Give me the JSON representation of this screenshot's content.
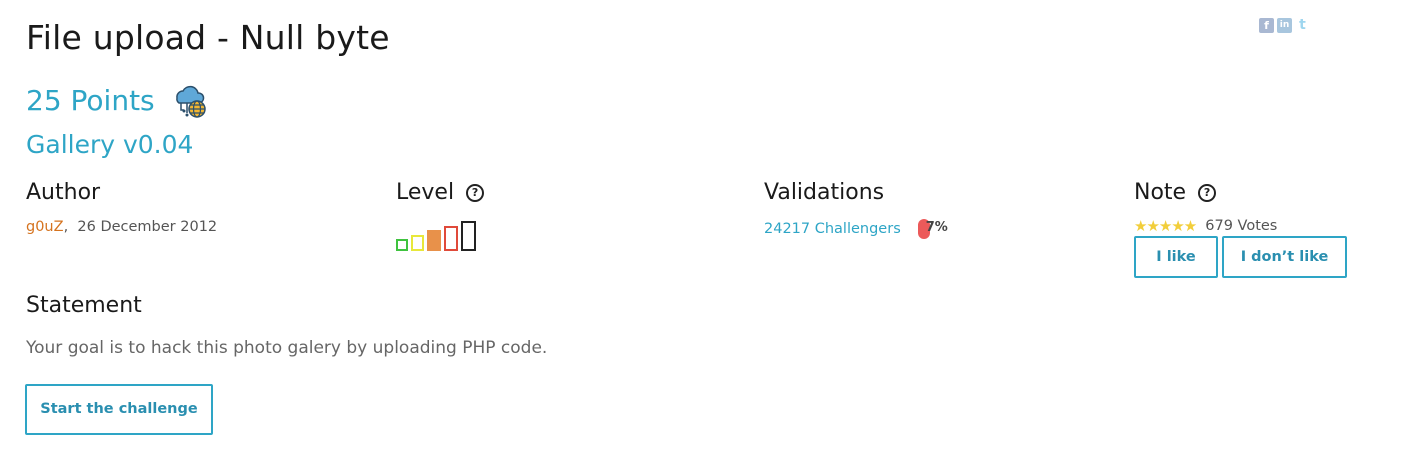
{
  "challenge": {
    "title": "File upload - Null byte",
    "points": "25 Points",
    "subtitle": "Gallery v0.04"
  },
  "social": {
    "facebook": "f",
    "linkedin": "in",
    "twitter": "t"
  },
  "author": {
    "heading": "Author",
    "name": "g0uZ",
    "date": "26 December 2012"
  },
  "level": {
    "heading": "Level",
    "help": "?",
    "current": 3,
    "max": 5,
    "colors": [
      "#3fc33f",
      "#e8e83a",
      "#e8914a",
      "#e04a3a",
      "#222222"
    ]
  },
  "validations": {
    "heading": "Validations",
    "challengers": "24217 Challengers",
    "percent": "7%"
  },
  "note": {
    "heading": "Note",
    "help": "?",
    "stars": "★★★★★",
    "rating": 5,
    "votes": "679 Votes",
    "like_label": "I like",
    "dislike_label": "I don’t like"
  },
  "statement": {
    "heading": "Statement",
    "text": "Your goal is to hack this photo galery by uploading PHP code."
  },
  "actions": {
    "start_label": "Start the challenge"
  },
  "colors": {
    "accent": "#2ea5c6",
    "author": "#d5731f",
    "percent_bar": "#ec5a5a",
    "stars": "#f2ce3b"
  }
}
